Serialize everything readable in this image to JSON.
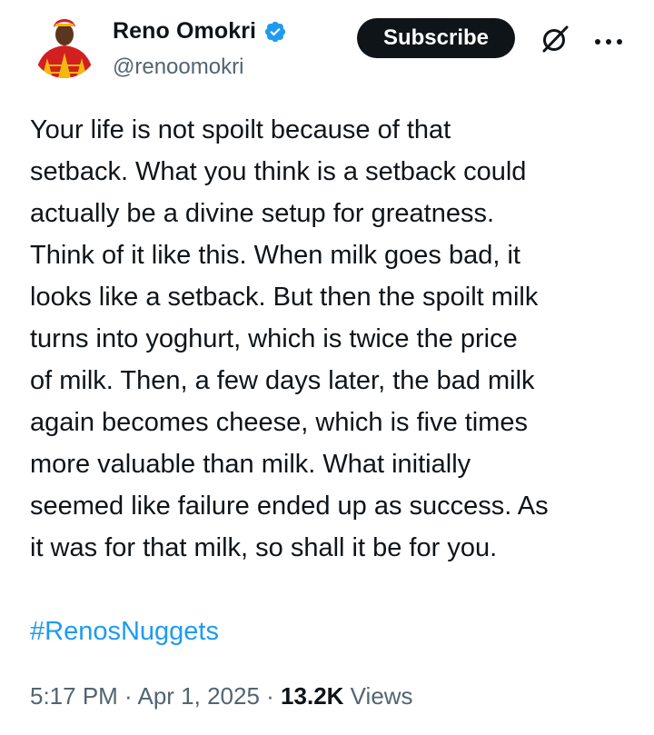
{
  "author": {
    "name": "Reno Omokri",
    "handle": "@renoomokri",
    "verified": true,
    "verified_color": "#1d9bf0"
  },
  "actions": {
    "subscribe_label": "Subscribe",
    "grok_icon": "grok-icon",
    "more_icon": "more-icon"
  },
  "tweet": {
    "text": "Your life is not spoilt because of that\nsetback. What you think is a setback could\nactually be a divine setup for greatness.\nThink of it like this. When milk goes bad, it\nlooks like a setback. But then the spoilt milk\nturns into yoghurt, which is twice the price\nof milk. Then, a few days later, the bad milk\nagain becomes cheese, which is five times\nmore valuable than milk. What initially\nseemed like failure ended up as success. As\nit was for that milk, so shall it be for you.",
    "hashtag": "#RenosNuggets",
    "hashtag_color": "#1d9bf0"
  },
  "meta": {
    "time": "5:17 PM",
    "separator": " · ",
    "date": "Apr 1, 2025",
    "views_count": "13.2K",
    "views_label": "Views"
  }
}
